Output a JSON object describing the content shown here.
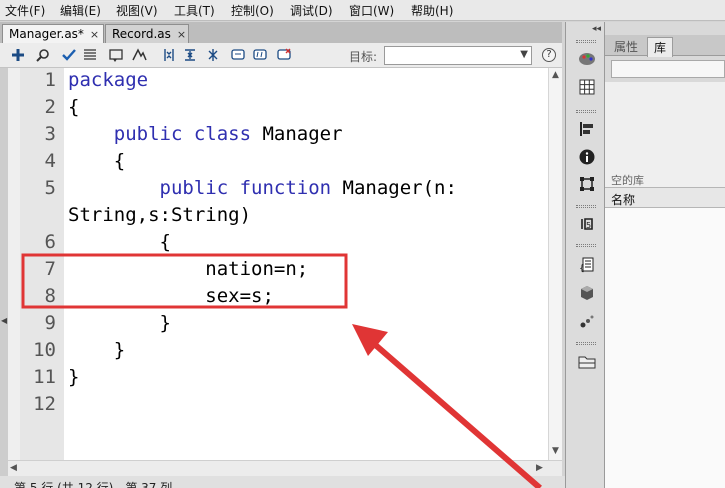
{
  "menu": [
    "文件(F)",
    "编辑(E)",
    "视图(V)",
    "工具(T)",
    "控制(O)",
    "调试(D)",
    "窗口(W)",
    "帮助(H)"
  ],
  "tabs": [
    {
      "label": "Manager.as*",
      "close": "×"
    },
    {
      "label": "Record.as",
      "close": "×"
    }
  ],
  "toolbar": {
    "icons": [
      "add-statement-icon",
      "find-icon",
      "check-syntax-icon",
      "auto-format-icon",
      "code-hint-icon",
      "debug-options-icon",
      "collapse-between-braces-icon",
      "collapse-selection-icon",
      "expand-all-icon",
      "apply-block-comment-icon",
      "apply-line-comment-icon",
      "remove-comment-icon"
    ],
    "target_label": "目标:",
    "target_value": "",
    "help": "?"
  },
  "editor": {
    "line_numbers": [
      "1",
      "2",
      "3",
      "4",
      "5",
      "",
      "6",
      "7",
      "8",
      "9",
      "10",
      "11",
      "12"
    ],
    "lines": [
      {
        "indent": "",
        "keyword": "package",
        "text": ""
      },
      {
        "indent": "",
        "keyword": "",
        "text": "{"
      },
      {
        "indent": "    ",
        "keyword": "public class",
        "text": " Manager"
      },
      {
        "indent": "    ",
        "keyword": "",
        "text": "{"
      },
      {
        "indent": "        ",
        "keyword": "public function",
        "text": " Manager(n:"
      },
      {
        "indent": "",
        "keyword": "",
        "text": "String,s:String)"
      },
      {
        "indent": "        ",
        "keyword": "",
        "text": "{"
      },
      {
        "indent": "            ",
        "keyword": "",
        "text": "nation=n;"
      },
      {
        "indent": "            ",
        "keyword": "",
        "text": "sex=s;"
      },
      {
        "indent": "        ",
        "keyword": "",
        "text": "}"
      },
      {
        "indent": "    ",
        "keyword": "",
        "text": "}"
      },
      {
        "indent": "",
        "keyword": "",
        "text": "}"
      },
      {
        "indent": "",
        "keyword": "",
        "text": ""
      }
    ],
    "keyword_color": "#2f2fb0"
  },
  "status": "第 5 行 (共 12 行)，第 37 列",
  "panel": {
    "tabs": [
      "属性",
      "库"
    ],
    "active_tab": "库",
    "empty_library": "空的库",
    "name_column": "名称"
  },
  "icon_strip": [
    "color-swatches-icon",
    "grid-icon",
    "align-icon",
    "info-icon",
    "transform-icon",
    "behaviors-icon",
    "components-icon",
    "library-3d-icon",
    "motion-presets-icon",
    "folder-icon"
  ],
  "annotation": {
    "box_color": "#e03535",
    "arrow_color": "#e03535"
  }
}
